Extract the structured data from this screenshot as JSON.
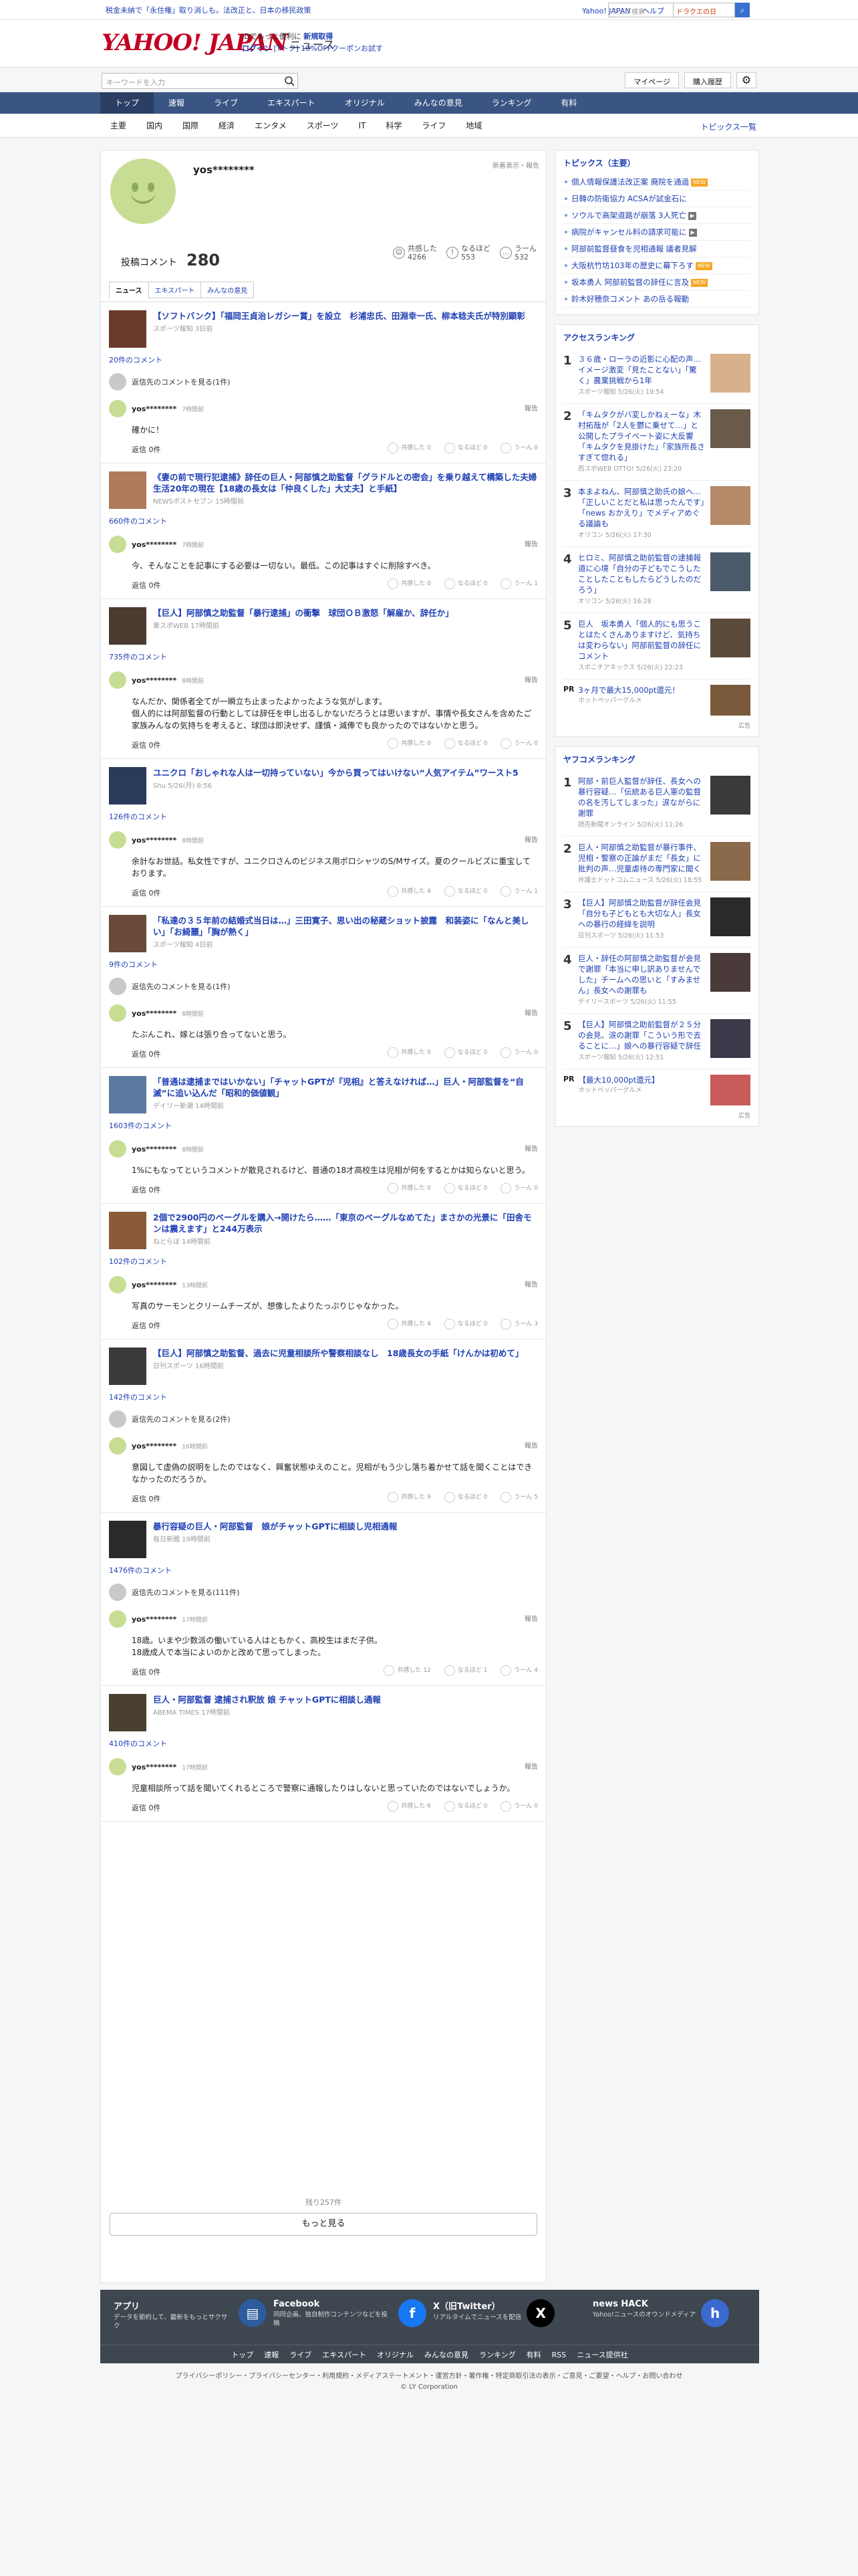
{
  "topstrip": {
    "tax": "税金未納で「永住権」取り消しも。法改正と、日本の移民政策",
    "links": [
      "Yahoo! JAPAN",
      "ヘルプ"
    ],
    "search_placeholder": "ウェブ検索",
    "search_btn": "ドラクエの日"
  },
  "header": {
    "logo": "YAHOO! JAPAN",
    "section": "ニュース",
    "promo_line1_a": "IDでもっと便利に",
    "promo_line1_b": "新規取得",
    "promo_login": "ログイン",
    "promo_coupon": "[Tトク] 10%OFFクーポンお試す"
  },
  "searchbar": {
    "placeholder": "キーワードを入力",
    "mypage": "マイページ",
    "purchased": "購入履歴"
  },
  "nav": [
    "トップ",
    "速報",
    "ライブ",
    "エキスパート",
    "オリジナル",
    "みんなの意見",
    "ランキング",
    "有料"
  ],
  "subnav": [
    "主要",
    "国内",
    "国際",
    "経済",
    "エンタメ",
    "スポーツ",
    "IT",
    "科学",
    "ライフ",
    "地域"
  ],
  "subnav_all": "トピックス一覧",
  "profile": {
    "name": "yos********",
    "report": "新着表示・報告",
    "posts_label": "投稿コメント",
    "posts_count": "280",
    "stats": [
      {
        "icon": "☺",
        "label": "共感した",
        "value": "4266"
      },
      {
        "icon": "!",
        "label": "なるほど",
        "value": "553"
      },
      {
        "icon": "…",
        "label": "うーん",
        "value": "532"
      }
    ],
    "tabs": [
      "ニュース",
      "エキスパート",
      "みんなの意見"
    ]
  },
  "items": [
    {
      "title": "【ソフトバンク】「福岡王貞治レガシー賞」を設立　杉浦忠氏、田淵幸一氏、柳本稔夫氏が特別顕彰",
      "src": "スポーツ報知 3日前",
      "count": "20件のコメント",
      "reply": "返信先のコメントを見る(1件)",
      "user": "yos********",
      "time": "7時間前",
      "text": "確かに！",
      "r": [
        "共感した 0",
        "なるほど 0",
        "うーん 0"
      ],
      "thumbColor": "#6a3a2a"
    },
    {
      "title": "《妻の前で現行犯逮捕》辞任の巨人・阿部慎之助監督「グラドルとの密会」を乗り越えて構築した夫婦生活20年の現在【18歳の長女は「仲良くした」大丈夫】と手紙】",
      "src": "NEWSポストセブン 15時間前",
      "count": "660件のコメント",
      "reply": "",
      "user": "yos********",
      "time": "7時間前",
      "text": "今、そんなことを記事にする必要は一切ない。最低。この記事はすぐに削除すべき。",
      "r": [
        "共感した 0",
        "なるほど 0",
        "うーん 1"
      ],
      "thumbColor": "#b07a5a"
    },
    {
      "title": "【巨人】阿部慎之助監督「暴行逮捕」の衝撃　球団ＯＢ激怒「解雇か、辞任か」",
      "src": "東スポWEB 17時間前",
      "count": "735件のコメント",
      "reply": "",
      "user": "yos********",
      "time": "8時間前",
      "text": "なんだか、関係者全てが一瞬立ち止まったよかったような気がします。\n個人的には阿部監督の行動としては辞任を申し出るしかないだろうとは思いますが、事情や長女さんを含めたご家族みんなの気持ちを考えると、球団は即決せず、謹慎・減俸でも良かったのではないかと思う。",
      "r": [
        "共感した 0",
        "なるほど 0",
        "うーん 0"
      ],
      "thumbColor": "#4a3a30"
    },
    {
      "title": "ユニクロ「おしゃれな人は一切持っていない」今から買ってはいけない“人気アイテム”ワースト5",
      "src": "Shu 5/26(月) 8:56",
      "count": "126件のコメント",
      "reply": "",
      "user": "yos********",
      "time": "8時間前",
      "text": "余計なお世話。私女性ですが、ユニクロさんのビジネス用ポロシャツのS/Mサイズ。夏のクールビズに重宝しております。",
      "r": [
        "共感した 4",
        "なるほど 0",
        "うーん 1"
      ],
      "thumbColor": "#2a3a5a"
    },
    {
      "title": "「私達の３５年前の結婚式当日は…」三田寛子、思い出の秘蔵ショット披露　和装姿に「なんと美しい」「お綺麗」「胸が熱く」",
      "src": "スポーツ報知 4日前",
      "count": "9件のコメント",
      "reply": "返信先のコメントを見る(1件)",
      "user": "yos********",
      "time": "8時間前",
      "text": "たぶんこれ、嫁とは張り合ってないと思う。",
      "r": [
        "共感した 0",
        "なるほど 0",
        "うーん 0"
      ],
      "thumbColor": "#6a4a3a"
    },
    {
      "title": "「普通は逮捕まではいかない」「チャットGPTが『児相』と答えなければ…」巨人・阿部監督を“自滅”に追い込んだ「昭和的価値観」",
      "src": "デイリー新潮 14時間前",
      "count": "1603件のコメント",
      "reply": "",
      "user": "yos********",
      "time": "8時間前",
      "text": "1%にもなってというコメントが散見されるけど、普通の18才高校生は児相が何をするとかは知らないと思う。",
      "r": [
        "共感した 0",
        "なるほど 0",
        "うーん 0"
      ],
      "thumbColor": "#5a7aa0"
    },
    {
      "title": "2個で2900円のベーグルを購入→開けたら……「東京のベーグルなめてた」まさかの光景に「田舎モンは震えます」と244万表示",
      "src": "ねとらぼ 14時間前",
      "count": "102件のコメント",
      "reply": "",
      "user": "yos********",
      "time": "13時間前",
      "text": "写真のサーモンとクリームチーズが、想像したよりたっぷりじゃなかった。",
      "r": [
        "共感した 4",
        "なるほど 0",
        "うーん 3"
      ],
      "thumbColor": "#8a5a3a"
    },
    {
      "title": "【巨人】阿部慎之助監督、過去に児童相談所や警察相談なし　18歳長女の手紙「けんかは初めて」",
      "src": "日刊スポーツ 16時間前",
      "count": "142件のコメント",
      "reply": "返信先のコメントを見る(2件)",
      "user": "yos********",
      "time": "16時間前",
      "text": "意図して虚偽の説明をしたのではなく、興奮状態ゆえのこと。児相がもう少し落ち着かせて話を聞くことはできなかったのだろうか。",
      "r": [
        "共感した 9",
        "なるほど 0",
        "うーん 5"
      ],
      "thumbColor": "#3a3a3a"
    },
    {
      "title": "暴行容疑の巨人・阿部監督　娘がチャットGPTに相談し児相通報",
      "src": "毎日新聞 19時間前",
      "count": "1476件のコメント",
      "reply": "返信先のコメントを見る(111件)",
      "user": "yos********",
      "time": "17時間前",
      "text": "18歳。いまや少数派の働いている人はともかく、高校生はまだ子供。\n18歳成人で本当によいのかと改めて思ってしまった。",
      "r": [
        "共感した 12",
        "なるほど 1",
        "うーん 4"
      ],
      "thumbColor": "#2a2a2a"
    },
    {
      "title": "巨人・阿部監督 逮捕され釈放 娘 チャットGPTに相談し通報",
      "src": "ABEMA TIMES 17時間前",
      "count": "410件のコメント",
      "reply": "",
      "user": "yos********",
      "time": "17時間前",
      "text": "児童相談所って話を聞いてくれるところで警察に通報したりはしないと思っていたのではないでしょうか。",
      "r": [
        "共感した 6",
        "なるほど 0",
        "うーん 0"
      ],
      "thumbColor": "#4a4030"
    }
  ],
  "reply_label": "返信 0件",
  "report_label": "報告",
  "more": {
    "remaining": "残り257件",
    "button": "もっと見る"
  },
  "side": {
    "topics_title": "トピックス（主要）",
    "topics": [
      {
        "t": "個人情報保護法改正案 廃院を通過",
        "b": "new"
      },
      {
        "t": "日韓の防衛協力 ACSAが試金石に",
        "b": ""
      },
      {
        "t": "ソウルで高架道路が崩落 3人死亡",
        "b": "cam"
      },
      {
        "t": "病院がキャンセル料の請求可能に",
        "b": "cam"
      },
      {
        "t": "阿部前監督昼食を児相通報 議者見解",
        "b": ""
      },
      {
        "t": "大阪杭竹坊103年の歴史に幕下ろす",
        "b": "new"
      },
      {
        "t": "坂本勇人 阿部前監督の辞任に言及",
        "b": "new"
      },
      {
        "t": "鈴木好穂奈コメント あの岳る報動",
        "b": ""
      }
    ],
    "access_title": "アクセスランキング",
    "access": [
      {
        "t": "３６歳・ローラの近影に心配の声…イメージ激変「見たことない」「驚く」農業挑戦から1年",
        "s": "スポーツ報知 5/26(火) 19:54",
        "c": "#d9b08c"
      },
      {
        "t": "「キムタクがバ変しかねぇーな」木村拓哉が「2人を鬱に乗せて…」と公開したプライベート姿に大反響「キムタクを見掛けた」「家族所長さすぎて惚れる」",
        "s": "西スポWEB OTTO! 5/26(火) 23:20",
        "c": "#6a5a4a"
      },
      {
        "t": "本まよねん、阿部慎之助氏の娘へ…「正しいことだと私は思ったんです」「news おかえり」でメディアめぐる議論も",
        "s": "オリコン 5/26(火) 17:30",
        "c": "#b58b6a"
      },
      {
        "t": "ヒロミ、阿部慎之助前監督の逮捕報道に心境「自分の子どもでこうしたことしたこともしたらどうしたのだろう」",
        "s": "オリコン 5/26(火) 16:28",
        "c": "#4a5a6a"
      },
      {
        "t": "巨人　坂本勇人「個人的にも思うことはたくさんありますけど、気持ちは変わらない」阿部前監督の辞任にコメント",
        "s": "スポニチアネックス 5/26(火) 22:23",
        "c": "#5a4a3a"
      }
    ],
    "pr1": {
      "tag": "PR",
      "t": "3ヶ月で最大15,000pt還元！",
      "s": "ホットペッパーグルメ"
    },
    "yaco_title": "ヤフコメランキング",
    "yaco": [
      {
        "t": "阿部・前巨人監督が辞任、長女への暴行容疑…「伝統ある巨人軍の監督の名を汚してしまった」涙ながらに謝罪",
        "s": "読売新聞オンライン 5/26(火) 11:26",
        "c": "#3a3a3a"
      },
      {
        "t": "巨人・阿部慎之助監督が暴行事件、児相・警察の正論がまだ「長女」に批判の声…児童虐待の専門家に聞く",
        "s": "弁護士ドットコムニュース 5/26(火) 18:55",
        "c": "#8a6a4a"
      },
      {
        "t": "【巨人】阿部慎之助監督が辞任会見「自分も子どもとも大切な人」長女への暴行の経緯を説明",
        "s": "日刊スポーツ 5/26(火) 11:53",
        "c": "#2a2a2a"
      },
      {
        "t": "巨人・辞任の阿部慎之助監督が会見で謝罪「本当に申し訳ありませんでした」チームへの思いと「すみません」長女への謝罪も",
        "s": "デイリースポーツ 5/26(火) 11:55",
        "c": "#4a3a3a"
      },
      {
        "t": "【巨人】阿部慎之助前監督が２５分の会見、涙の謝罪「こういう形で去ることに…」娘への暴行容疑で辞任",
        "s": "スポーツ報知 5/26(火) 12:51",
        "c": "#3a3a4a"
      }
    ],
    "pr2": {
      "tag": "PR",
      "t": "【最大10,000pt還元】",
      "s": "ホットペッパーグルメ"
    },
    "ad": "広告"
  },
  "footer": {
    "apps": [
      {
        "t": "アプリ",
        "d": "データを節約して、最新をもっとサクサク",
        "icon": "▤"
      },
      {
        "t": "Facebook",
        "d": "同同企画、独自制作コンテンツなどを投稿",
        "icon": "f"
      },
      {
        "t": "X（旧Twitter）",
        "d": "リアルタイムでニュースを配信",
        "icon": "X"
      },
      {
        "t": "news HACK",
        "d": "Yahoo!ニュースのオウンドメディア",
        "icon": "h"
      }
    ],
    "nav": [
      "トップ",
      "速報",
      "ライブ",
      "エキスパート",
      "オリジナル",
      "みんなの意見",
      "ランキング",
      "有料",
      "RSS",
      "ニュース提供社"
    ],
    "links": "プライバシーポリシー・プライバシーセンター・利用規約・メディアステートメント・運営方針・著作権・特定商取引法の表示・ご意見・ご要望・ヘルプ・お問い合わせ",
    "copyright": "© LY Corporation"
  }
}
